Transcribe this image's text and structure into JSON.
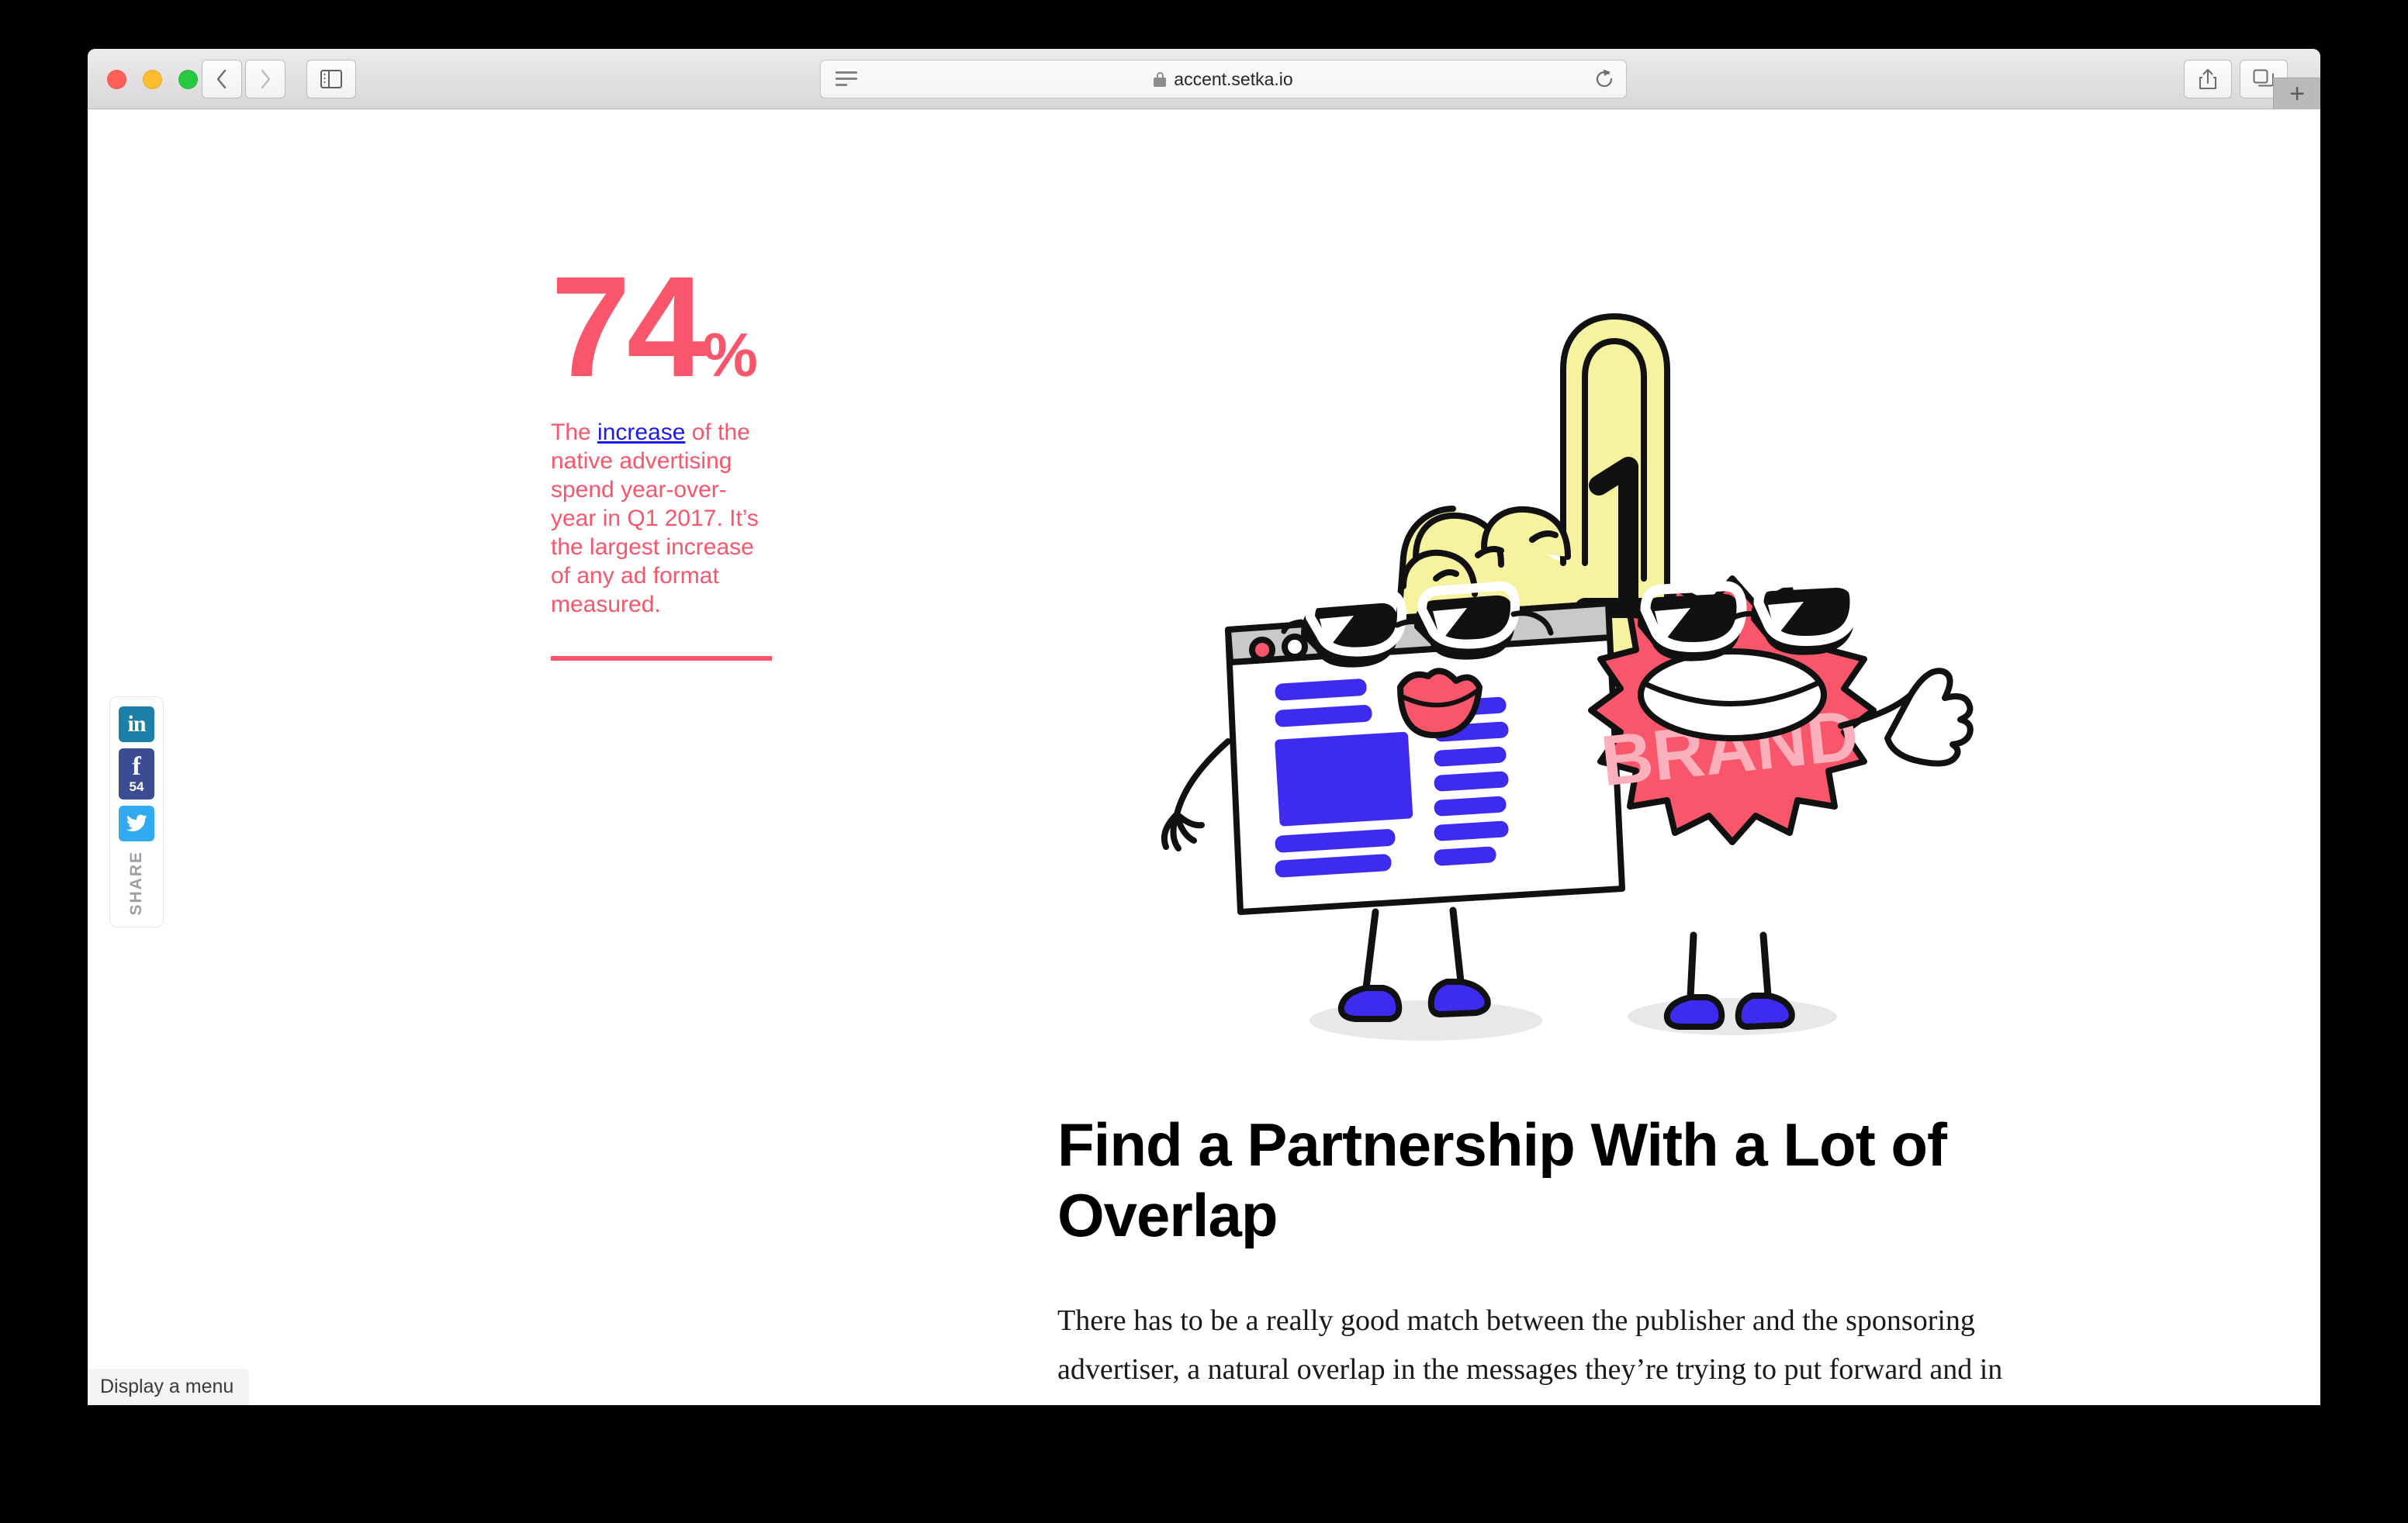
{
  "browser": {
    "name": "safari",
    "url": "accent.setka.io",
    "traffic_lights": [
      "close",
      "minimize",
      "zoom"
    ],
    "buttons": {
      "back": "back-button",
      "forward": "forward-button",
      "sidebar": "sidebar-toggle",
      "reader": "reader-view-icon",
      "reload": "reload-button",
      "share": "share-button",
      "tabs": "tabs-overview-button",
      "new_tab": "+"
    },
    "status_bar_text": "Display a menu"
  },
  "share_rail": {
    "label": "SHARE",
    "items": [
      {
        "network": "LinkedIn",
        "glyph": "in",
        "color": "#1b7fa8",
        "count": ""
      },
      {
        "network": "Facebook",
        "glyph": "f",
        "color": "#3b4c93",
        "count": "54"
      },
      {
        "network": "Twitter",
        "glyph": "bird",
        "color": "#32aaf2",
        "count": ""
      }
    ]
  },
  "stat": {
    "number": "74",
    "unit": "%",
    "caption_before": "The ",
    "caption_link": "increase",
    "caption_after": " of the native advertising spend year-over-year in Q1 2017. It’s the largest increase of any ad format measured.",
    "accent_color": "#f9566c",
    "link_color": "#1b1bf0"
  },
  "illustration": {
    "name": "foam-finger-browser-brand-characters",
    "foam_finger_number": "1",
    "badge_text": "BRAND",
    "colors": {
      "foam_finger": "#f7f2a0",
      "badge": "#f9566c",
      "badge_text": "#fcb0bb",
      "browser_blocks": "#3d2bef",
      "lips": "#f9566c",
      "shoes": "#3d2bef",
      "titlebar": "#c9c9c9"
    }
  },
  "article": {
    "heading": "Find a Partnership With a Lot of Overlap",
    "body": "There has to be a really good match between the publisher and the sponsoring advertiser, a natural overlap in the messages they’re trying to put forward and in the audience that they want to reach. The marriage those two things is incredibly important."
  }
}
